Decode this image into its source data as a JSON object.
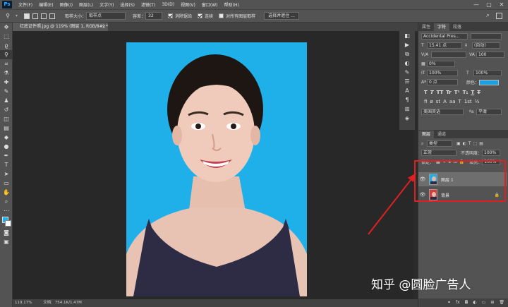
{
  "app": {
    "logo": "Ps"
  },
  "menu": [
    "文件(F)",
    "编辑(E)",
    "图像(I)",
    "图层(L)",
    "文字(Y)",
    "选择(S)",
    "滤镜(T)",
    "3D(D)",
    "视图(V)",
    "窗口(W)",
    "帮助(H)"
  ],
  "window_controls": [
    "—",
    "▢",
    "✕"
  ],
  "options": {
    "sample_size_label": "取样大小：",
    "sample_size_value": "取样点",
    "tolerance_label": "容差：",
    "tolerance_value": "32",
    "antialias": "消除锯齿",
    "contiguous": "连续",
    "sample_all_layers": "对所有图层取样",
    "select_subject": "选择并遮住 ..."
  },
  "document": {
    "tab_title": "红底证件照.jpg @ 119% (图层 1, RGB/8#) *",
    "tab_close": "×",
    "zoom": "119.17%",
    "file_info": "文档：754.1K/1.47M"
  },
  "panels": {
    "top_tabs": [
      "属性",
      "字符",
      "段落"
    ],
    "character": {
      "font_family": "Accidental Pres...",
      "font_size": "15.41 点",
      "leading": "(自动)",
      "tracking": "100",
      "kerning_pct": "0%",
      "vscale": "100%",
      "hscale": "100%",
      "baseline": "0 点",
      "color_label": "颜色：",
      "text_color": "#1fa0df",
      "style_buttons": [
        "T",
        "T",
        "TT",
        "Tr",
        "T¹",
        "T₁",
        "T",
        "T"
      ],
      "ot_buttons": [
        "fi",
        "ø",
        "st",
        "A",
        "aa",
        "T",
        "1st",
        "½"
      ],
      "language": "美国英语",
      "antialias": "平滑"
    },
    "layers_tabs": [
      "图层",
      "通道"
    ],
    "layers": {
      "filter_label": "类型",
      "blend_mode": "正常",
      "opacity_label": "不透明度：",
      "opacity": "100%",
      "lock_label": "锁定：",
      "fill_label": "填充：",
      "fill": "100%",
      "items": [
        {
          "name": "图层 1",
          "visible": true,
          "selected": true
        },
        {
          "name": "背景",
          "visible": true,
          "selected": false,
          "locked": true
        }
      ]
    }
  },
  "photo": {
    "background_color": "#1fb0ea"
  },
  "annotation": {
    "highlight_color": "#e02020"
  },
  "watermark": "知乎 @圆脸广告人"
}
